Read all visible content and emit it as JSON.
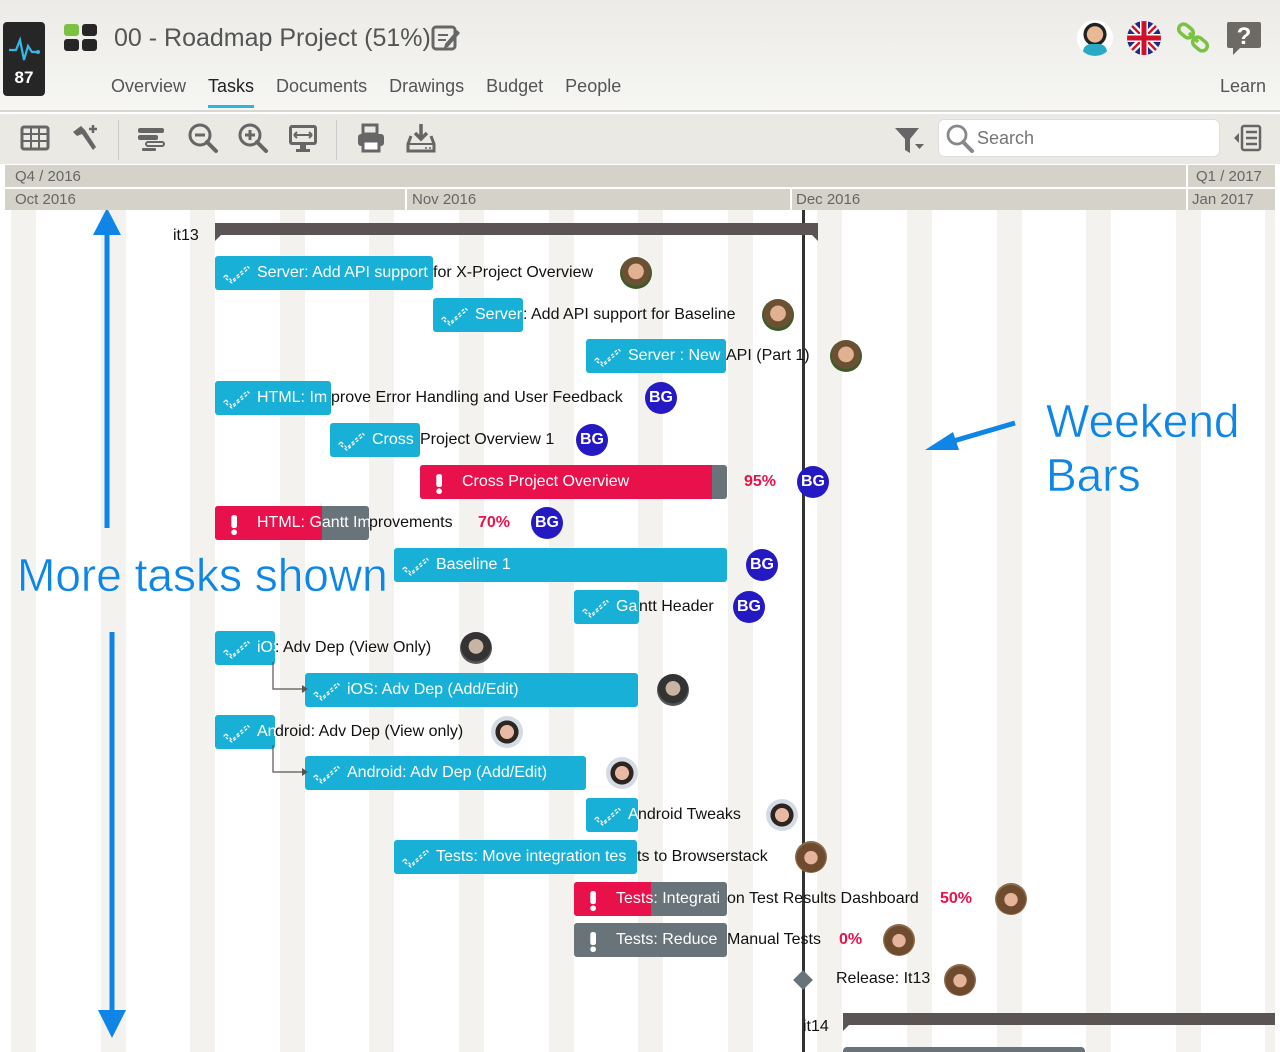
{
  "pulse": {
    "score": "87",
    "icon": "pulse-icon"
  },
  "header": {
    "title": "00 - Roadmap Project (51%)",
    "tabs": [
      {
        "label": "Overview",
        "active": false
      },
      {
        "label": "Tasks",
        "active": true
      },
      {
        "label": "Documents",
        "active": false
      },
      {
        "label": "Drawings",
        "active": false
      },
      {
        "label": "Budget",
        "active": false
      },
      {
        "label": "People",
        "active": false
      }
    ],
    "learn": "Learn",
    "icons": [
      "user-avatar",
      "uk-flag-icon",
      "link-icon",
      "help-icon"
    ]
  },
  "toolbar": {
    "icons": [
      "grid-icon",
      "add-tool-icon",
      "gantt-bars-icon",
      "zoom-out-icon",
      "zoom-in-icon",
      "fit-screen-icon",
      "print-icon",
      "download-icon"
    ],
    "filter_icon": "filter-icon",
    "search_placeholder": "Search",
    "panel_toggle_icon": "collapse-panel-icon"
  },
  "timeline": {
    "quarters": [
      "Q4 / 2016",
      "Q1 / 2017"
    ],
    "months": [
      "Oct 2016",
      "Nov 2016",
      "Dec 2016",
      "Jan 2017"
    ]
  },
  "colors": {
    "task_blue": "#19b0d7",
    "critical_red": "#e8114c",
    "grey": "#69737a",
    "iteration": "#5a5455",
    "assignee_bg": "#2419c2",
    "annotation": "#0f86e6"
  },
  "iterations": [
    {
      "label": "it13"
    },
    {
      "label": "it14"
    }
  ],
  "tasks": [
    {
      "bar_text": "Server: Add API support",
      "ext_text": " for X-Project Overview",
      "type": "done",
      "assignee": "photo"
    },
    {
      "bar_text": "Server",
      "ext_text": ": Add API support for Baseline",
      "type": "done",
      "assignee": "photo"
    },
    {
      "bar_text": "Server : New ",
      "ext_text": "API (Part 1)",
      "type": "done",
      "assignee": "photo"
    },
    {
      "bar_text": "HTML: Im",
      "ext_text": "prove Error Handling and User Feedback",
      "type": "done",
      "assignee": "BG"
    },
    {
      "bar_text": "Cross ",
      "ext_text": "Project Overview 1",
      "type": "done",
      "assignee": "BG"
    },
    {
      "bar_text": "Cross Project Overview",
      "ext_text": "",
      "type": "critical",
      "progress": "95%",
      "assignee": "BG"
    },
    {
      "bar_text": "HTML: Gantt Im",
      "ext_text": "provements",
      "type": "critical",
      "progress": "70%",
      "assignee": "BG"
    },
    {
      "bar_text": "Baseline 1",
      "ext_text": "",
      "type": "done",
      "assignee": "BG"
    },
    {
      "bar_text": "Ga",
      "ext_text": "ntt Header",
      "type": "done",
      "assignee": "BG"
    },
    {
      "bar_text": "iOS",
      "ext_text": ": Adv Dep (View Only)",
      "type": "done",
      "assignee": "photo"
    },
    {
      "bar_text": "iOS: Adv Dep (Add/Edit)",
      "ext_text": "",
      "type": "done",
      "assignee": "photo"
    },
    {
      "bar_text": "An",
      "ext_text": "droid: Adv Dep (View only)",
      "type": "done",
      "assignee": "photo"
    },
    {
      "bar_text": "Android: Adv Dep (Add/Edit)",
      "ext_text": "",
      "type": "done",
      "assignee": "photo"
    },
    {
      "bar_text": "A",
      "ext_text": "ndroid Tweaks",
      "type": "done",
      "assignee": "photo"
    },
    {
      "bar_text": "Tests: Move integration tes",
      "ext_text": "ts to Browserstack",
      "type": "done",
      "assignee": "photo"
    },
    {
      "bar_text": "Tests: Integrati",
      "ext_text": "on Test Results Dashboard",
      "type": "critical",
      "progress": "50%",
      "assignee": "photo"
    },
    {
      "bar_text": "Tests: Reduce ",
      "ext_text": "Manual Tests",
      "type": "critical",
      "progress": "0%",
      "assignee": "photo"
    }
  ],
  "milestone": {
    "label": "Release: It13",
    "assignee": "photo"
  },
  "annotations": {
    "more_tasks": "More tasks shown",
    "weekend_line1": "Weekend",
    "weekend_line2": "Bars"
  }
}
